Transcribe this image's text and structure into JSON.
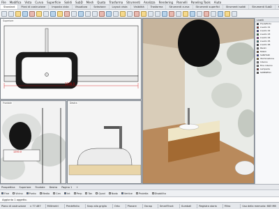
{
  "menu": [
    "File",
    "Modifica",
    "Vista",
    "Curva",
    "Superficie",
    "Solidi",
    "SubD",
    "Mesh",
    "Quota",
    "Trasforma",
    "Strumenti",
    "Analizza",
    "Rendering",
    "Pannelli",
    "Paneling Tools",
    "Aiuto"
  ],
  "tabs": [
    "Standard",
    "Piani di costruzione",
    "Imposta vista",
    "Visualizza",
    "Selezione",
    "Layout vista",
    "Visibilità",
    "Trasforma",
    "Strumenti curva",
    "Strumenti superfici",
    "Strumenti solidi",
    "Strumenti SubD",
    "Strumenti mesh",
    "Strumenti di rendering",
    "Disegno",
    "Novità di V8"
  ],
  "viewports": {
    "top": "Superiore",
    "perspective": "Prospettica",
    "left1": "Frontale",
    "left2": "Destra"
  },
  "dimension": "1200.0",
  "dimension_small": "1200.0",
  "layers_panel": {
    "title": "Livelli",
    "items": [
      {
        "name": "Predefinito",
        "color": "#000000"
      },
      {
        "name": "Livello 01",
        "color": "#ff0000"
      },
      {
        "name": "Livello 02",
        "color": "#0000ff"
      },
      {
        "name": "Livello 03",
        "color": "#00aa00"
      },
      {
        "name": "Livello 04",
        "color": "#ff00ff"
      },
      {
        "name": "Livello 05",
        "color": "#00aaaa"
      },
      {
        "name": "Livello 06",
        "color": "#000000"
      },
      {
        "name": "Pareti",
        "color": "#777777"
      },
      {
        "name": "Mobili",
        "color": "#994c00"
      },
      {
        "name": "SANITARI",
        "color": "#0000ff"
      },
      {
        "name": "Illuminazione",
        "color": "#ffaa00"
      },
      {
        "name": "Interno",
        "color": "#999999"
      },
      {
        "name": "Fine interno",
        "color": "#aaaaaa"
      },
      {
        "name": "Lampada",
        "color": "#cc0000"
      },
      {
        "name": "SUPERFICI",
        "color": "#555555"
      }
    ]
  },
  "viewport_tabs": [
    "Prospettica",
    "Superiore",
    "Frontale",
    "Destra",
    "Pagina 1",
    "+"
  ],
  "osnap": [
    {
      "label": "Fine",
      "on": true
    },
    {
      "label": "Vicino",
      "on": false
    },
    {
      "label": "Punto",
      "on": true
    },
    {
      "label": "Medio",
      "on": false
    },
    {
      "label": "Cen",
      "on": false
    },
    {
      "label": "Int",
      "on": true
    },
    {
      "label": "Perp",
      "on": false
    },
    {
      "label": "Tan",
      "on": false
    },
    {
      "label": "Quad",
      "on": false
    },
    {
      "label": "Nodo",
      "on": false
    },
    {
      "label": "Vertice",
      "on": true
    },
    {
      "label": "Proietta",
      "on": false
    },
    {
      "label": "Disabilita",
      "on": false
    }
  ],
  "command_line": "Aggiunto 1 oggetto.",
  "status": {
    "cplane": "Piano di costruzione",
    "coords": "x 77.487",
    "units": "Millimetri",
    "layer": "Predefinito",
    "toggles": [
      "Snap alla griglia",
      "Orto",
      "Planare",
      "Osnap",
      "SmartTrack",
      "Gumball",
      "Registra storia",
      "Filtro"
    ],
    "memory": "Uso della memoria: 683 MB"
  }
}
